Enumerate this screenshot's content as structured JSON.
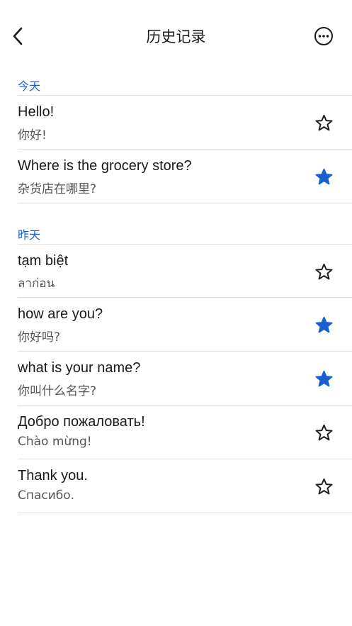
{
  "header": {
    "title": "历史记录"
  },
  "sections": [
    {
      "label": "今天",
      "items": [
        {
          "source": "Hello!",
          "target": "你好!",
          "starred": false
        },
        {
          "source": "Where is the grocery store?",
          "target": "杂货店在哪里?",
          "starred": true
        }
      ]
    },
    {
      "label": "昨天",
      "items": [
        {
          "source": "tạm biệt",
          "target": "ลาก่อน",
          "starred": false
        },
        {
          "source": "how are you?",
          "target": "你好吗?",
          "starred": true
        },
        {
          "source": "what is your name?",
          "target": "你叫什么名字?",
          "starred": true
        },
        {
          "source": "Добро пожаловать!",
          "target": "Chào mừng!",
          "starred": false
        },
        {
          "source": "Thank you.",
          "target": "Спасибо.",
          "starred": false
        }
      ]
    }
  ],
  "colors": {
    "accent": "#1a5fd0",
    "star_filled": "#1a5fd0",
    "star_outline": "#1a1a1a"
  }
}
